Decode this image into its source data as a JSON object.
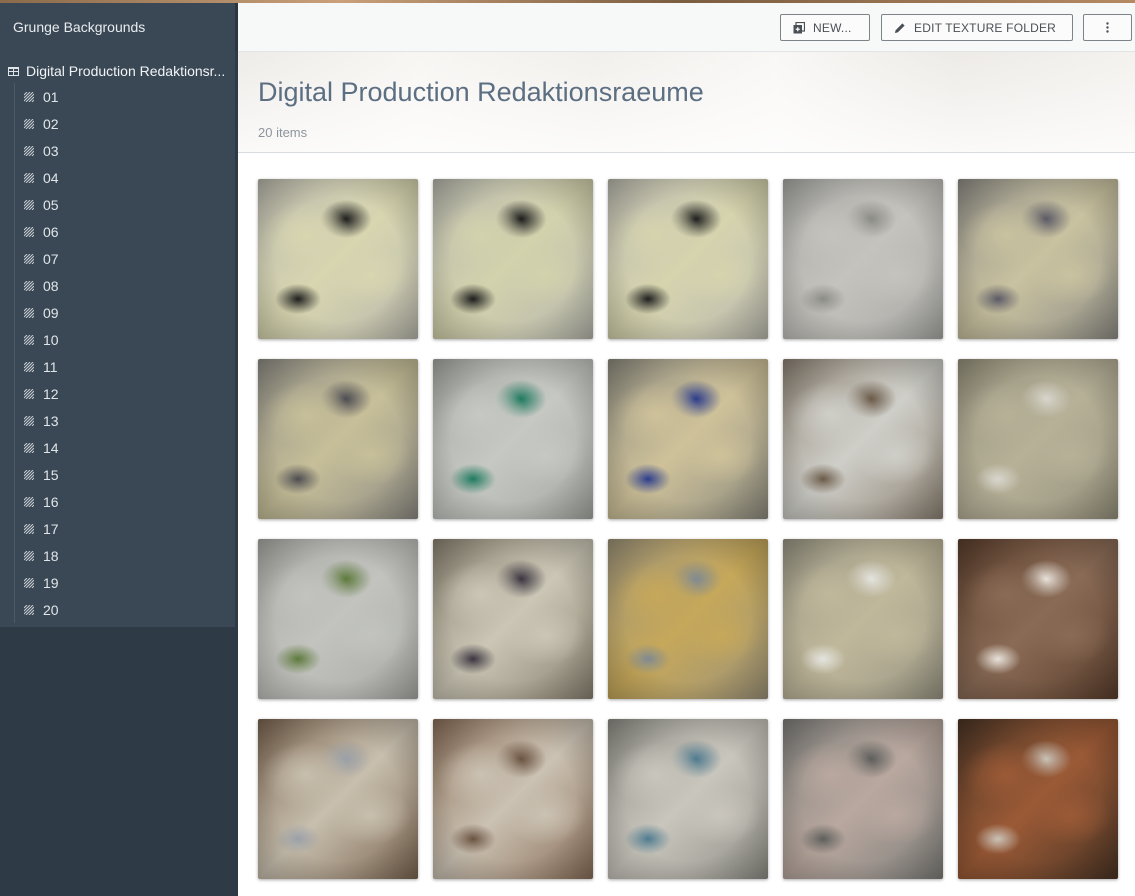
{
  "sidebar": {
    "title": "Grunge Backgrounds",
    "root": {
      "label": "Digital Production Redaktionsr...",
      "icon": "folder-grid-icon"
    },
    "items": [
      {
        "label": "01"
      },
      {
        "label": "02"
      },
      {
        "label": "03"
      },
      {
        "label": "04"
      },
      {
        "label": "05"
      },
      {
        "label": "06"
      },
      {
        "label": "07"
      },
      {
        "label": "08"
      },
      {
        "label": "09"
      },
      {
        "label": "10"
      },
      {
        "label": "11"
      },
      {
        "label": "12"
      },
      {
        "label": "13"
      },
      {
        "label": "14"
      },
      {
        "label": "15"
      },
      {
        "label": "16"
      },
      {
        "label": "17"
      },
      {
        "label": "18"
      },
      {
        "label": "19"
      },
      {
        "label": "20"
      }
    ]
  },
  "toolbar": {
    "new_label": "NEW...",
    "edit_label": "EDIT TEXTURE FOLDER",
    "more_icon": "more-vertical-icon"
  },
  "header": {
    "title": "Digital Production Redaktionsraeume",
    "count": "20 items"
  },
  "textures": [
    {
      "name": "01",
      "base": "#b9b8ac",
      "tone": "#d8d6b0",
      "accent": "#1e1e1e"
    },
    {
      "name": "02",
      "base": "#b7b7ad",
      "tone": "#d3d2ad",
      "accent": "#1c1c1c"
    },
    {
      "name": "03",
      "base": "#bab9ae",
      "tone": "#d6d4ae",
      "accent": "#1f1f1f"
    },
    {
      "name": "04",
      "base": "#a9a9a5",
      "tone": "#c4c3bd",
      "accent": "#8c8c86"
    },
    {
      "name": "05",
      "base": "#8f8d86",
      "tone": "#c9c2a0",
      "accent": "#5b5a66"
    },
    {
      "name": "06",
      "base": "#8e8c84",
      "tone": "#c7bf99",
      "accent": "#4d4c52"
    },
    {
      "name": "07",
      "base": "#a6a8a3",
      "tone": "#c6c8c3",
      "accent": "#1f7a5f"
    },
    {
      "name": "08",
      "base": "#8c8a7e",
      "tone": "#cfc29a",
      "accent": "#2c3d8c"
    },
    {
      "name": "09",
      "base": "#8d8274",
      "tone": "#cfcfc9",
      "accent": "#6a5a48"
    },
    {
      "name": "10",
      "base": "#96917c",
      "tone": "#b7b198",
      "accent": "#d8d6cd"
    },
    {
      "name": "11",
      "base": "#a9aaa5",
      "tone": "#c2c3be",
      "accent": "#5d7a3c"
    },
    {
      "name": "12",
      "base": "#8a8272",
      "tone": "#cbc6b5",
      "accent": "#3b3540"
    },
    {
      "name": "13",
      "base": "#9c9278",
      "tone": "#c6a85a",
      "accent": "#7f8a92"
    },
    {
      "name": "14",
      "base": "#9a9684",
      "tone": "#c0b89b",
      "accent": "#e4e4df"
    },
    {
      "name": "15",
      "base": "#5a3e2c",
      "tone": "#8a6b56",
      "accent": "#e8e2da"
    },
    {
      "name": "16",
      "base": "#7b6550",
      "tone": "#c8bfae",
      "accent": "#9aa0a8"
    },
    {
      "name": "17",
      "base": "#8a6e58",
      "tone": "#cbc2b3",
      "accent": "#6a5240"
    },
    {
      "name": "18",
      "base": "#8e8d85",
      "tone": "#c9c6bd",
      "accent": "#4f7b8f"
    },
    {
      "name": "19",
      "base": "#7e7e7a",
      "tone": "#b9a89f",
      "accent": "#5e5e5b"
    },
    {
      "name": "20",
      "base": "#4a3424",
      "tone": "#9b5a36",
      "accent": "#c9c2b8"
    }
  ]
}
